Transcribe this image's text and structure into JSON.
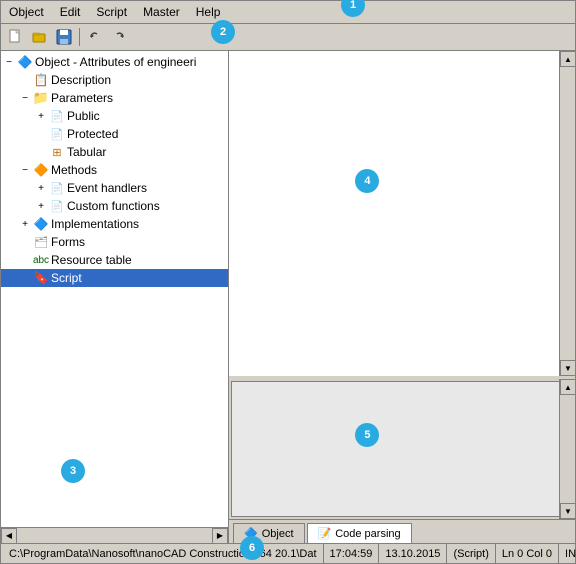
{
  "menubar": {
    "items": [
      "Object",
      "Edit",
      "Script",
      "Master",
      "Help"
    ]
  },
  "toolbar": {
    "buttons": [
      "new",
      "open",
      "save",
      "undo",
      "redo"
    ]
  },
  "annotations": [
    {
      "id": 1,
      "label": "1"
    },
    {
      "id": 2,
      "label": "2"
    },
    {
      "id": 3,
      "label": "3"
    },
    {
      "id": 4,
      "label": "4"
    },
    {
      "id": 5,
      "label": "5"
    },
    {
      "id": 6,
      "label": "6"
    }
  ],
  "tree": {
    "root": "Object - Attributes of engineeri",
    "items": [
      {
        "id": "description",
        "label": "Description",
        "indent": 1,
        "icon": "desc",
        "expander": ""
      },
      {
        "id": "parameters",
        "label": "Parameters",
        "indent": 1,
        "icon": "folder",
        "expander": "−"
      },
      {
        "id": "public",
        "label": "Public",
        "indent": 2,
        "icon": "page",
        "expander": "+"
      },
      {
        "id": "protected",
        "label": "Protected",
        "indent": 2,
        "icon": "page",
        "expander": ""
      },
      {
        "id": "tabular",
        "label": "Tabular",
        "indent": 2,
        "icon": "table",
        "expander": ""
      },
      {
        "id": "methods",
        "label": "Methods",
        "indent": 1,
        "icon": "folder",
        "expander": "−"
      },
      {
        "id": "eventhandlers",
        "label": "Event handlers",
        "indent": 2,
        "icon": "event",
        "expander": "+"
      },
      {
        "id": "customfunctions",
        "label": "Custom functions",
        "indent": 2,
        "icon": "func",
        "expander": "+"
      },
      {
        "id": "implementations",
        "label": "Implementations",
        "indent": 1,
        "icon": "impl",
        "expander": "+"
      },
      {
        "id": "forms",
        "label": "Forms",
        "indent": 1,
        "icon": "forms",
        "expander": ""
      },
      {
        "id": "resourcetable",
        "label": "Resource table",
        "indent": 1,
        "icon": "abc",
        "expander": ""
      },
      {
        "id": "script",
        "label": "Script",
        "indent": 1,
        "icon": "script",
        "expander": "",
        "selected": true
      }
    ]
  },
  "tabs": [
    {
      "id": "object",
      "label": "Object",
      "active": false
    },
    {
      "id": "codeparsing",
      "label": "Code parsing",
      "active": true
    }
  ],
  "statusbar": {
    "path": "C:\\ProgramData\\Nanosoft\\nanoCAD Construction x64 20.1\\Dat",
    "time": "17:04:59",
    "date": "13.10.2015",
    "context": "(Script)",
    "position": "Ln 0 Col 0",
    "mode": "INS"
  }
}
